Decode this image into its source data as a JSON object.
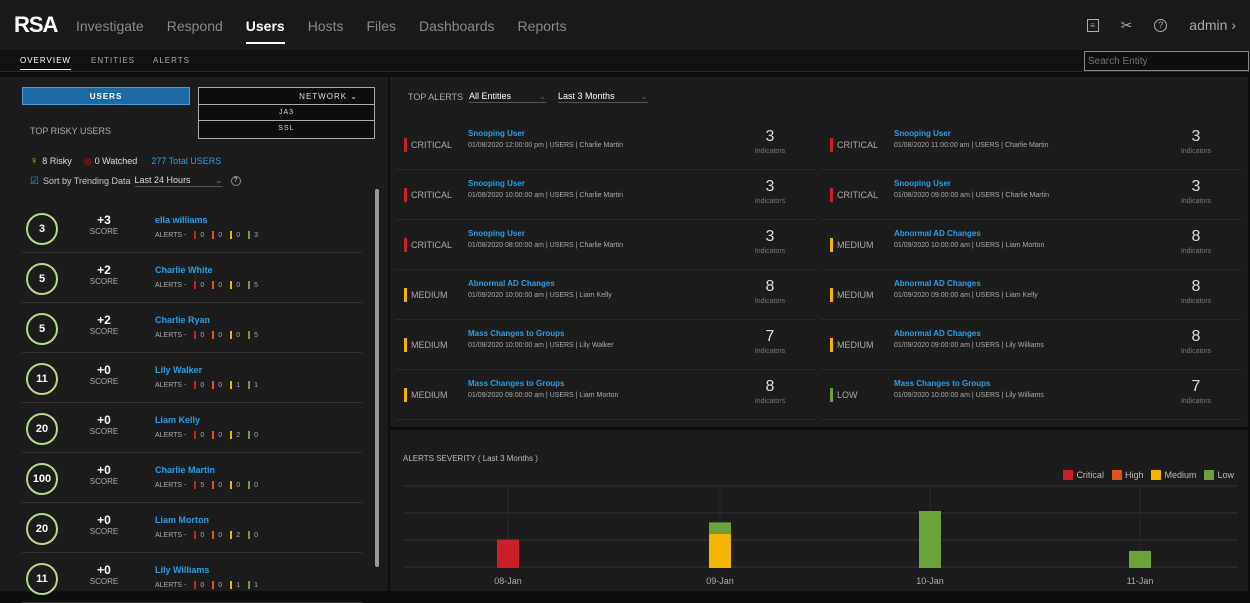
{
  "nav": {
    "logo": "RSA",
    "items": [
      "Investigate",
      "Respond",
      "Users",
      "Hosts",
      "Files",
      "Dashboards",
      "Reports"
    ],
    "user": "admin"
  },
  "subnav": {
    "tabs": [
      "OVERVIEW",
      "ENTITIES",
      "ALERTS"
    ],
    "search_placeholder": "Search Entity"
  },
  "left": {
    "users_btn": "USERS",
    "network_btn": "NETWORK",
    "dd_options": [
      "JA3",
      "SSL"
    ],
    "title": "TOP RISKY USERS",
    "risky": "8 Risky",
    "watched": "0 Watched",
    "total": "277 Total USERS",
    "sort_label": "Sort by Trending Data",
    "sort_value": "Last 24 Hours",
    "users": [
      {
        "score": "3",
        "delta": "+3",
        "name": "ella williams",
        "alerts": [
          "0",
          "0",
          "0",
          "3"
        ]
      },
      {
        "score": "5",
        "delta": "+2",
        "name": "Charlie White",
        "alerts": [
          "0",
          "0",
          "0",
          "5"
        ]
      },
      {
        "score": "5",
        "delta": "+2",
        "name": "Charlie Ryan",
        "alerts": [
          "0",
          "0",
          "0",
          "5"
        ]
      },
      {
        "score": "11",
        "delta": "+0",
        "name": "Lily Walker",
        "alerts": [
          "0",
          "0",
          "1",
          "1"
        ]
      },
      {
        "score": "20",
        "delta": "+0",
        "name": "Liam Kelly",
        "alerts": [
          "0",
          "0",
          "2",
          "0"
        ]
      },
      {
        "score": "100",
        "delta": "+0",
        "name": "Charlie Martin",
        "alerts": [
          "5",
          "0",
          "0",
          "0"
        ]
      },
      {
        "score": "20",
        "delta": "+0",
        "name": "Liam Morton",
        "alerts": [
          "0",
          "0",
          "2",
          "0"
        ]
      },
      {
        "score": "11",
        "delta": "+0",
        "name": "Lily Williams",
        "alerts": [
          "0",
          "0",
          "1",
          "1"
        ]
      }
    ],
    "score_label": "SCORE",
    "alerts_label": "ALERTS -"
  },
  "top_alerts": {
    "title": "TOP ALERTS",
    "filter1": "All Entities",
    "filter2": "Last 3 Months",
    "indicators_label": "Indicators",
    "alerts": [
      {
        "sev": "CRITICAL",
        "title": "Snooping User",
        "meta": "01/08/2020 12:00:00 pm  |  USERS  |  Charlie Martin",
        "count": "3"
      },
      {
        "sev": "CRITICAL",
        "title": "Snooping User",
        "meta": "01/08/2020 11:00:00 am  |  USERS  |  Charlie Martin",
        "count": "3"
      },
      {
        "sev": "CRITICAL",
        "title": "Snooping User",
        "meta": "01/08/2020 10:00:00 am  |  USERS  |  Charlie Martin",
        "count": "3"
      },
      {
        "sev": "CRITICAL",
        "title": "Snooping User",
        "meta": "01/08/2020 09:00:00 am  |  USERS  |  Charlie Martin",
        "count": "3"
      },
      {
        "sev": "CRITICAL",
        "title": "Snooping User",
        "meta": "01/08/2020 08:00:00 am  |  USERS  |  Charlie Martin",
        "count": "3"
      },
      {
        "sev": "MEDIUM",
        "title": "Abnormal AD Changes",
        "meta": "01/09/2020 10:00:00 am  |  USERS  |  Liam Morton",
        "count": "8"
      },
      {
        "sev": "MEDIUM",
        "title": "Abnormal AD Changes",
        "meta": "01/09/2020 10:00:00 am  |  USERS  |  Liam Kelly",
        "count": "8"
      },
      {
        "sev": "MEDIUM",
        "title": "Abnormal AD Changes",
        "meta": "01/09/2020 09:00:00 am  |  USERS  |  Liam Kelly",
        "count": "8"
      },
      {
        "sev": "MEDIUM",
        "title": "Mass Changes to Groups",
        "meta": "01/09/2020 10:00:00 am  |  USERS  |  Lily Walker",
        "count": "7"
      },
      {
        "sev": "MEDIUM",
        "title": "Abnormal AD Changes",
        "meta": "01/09/2020 09:00:00 am  |  USERS  |  Lily Williams",
        "count": "8"
      },
      {
        "sev": "MEDIUM",
        "title": "Mass Changes to Groups",
        "meta": "01/09/2020 09:00:00 am  |  USERS  |  Liam Morton",
        "count": "8"
      },
      {
        "sev": "LOW",
        "title": "Mass Changes to Groups",
        "meta": "01/09/2020 10:00:00 am  |  USERS  |  Lily Williams",
        "count": "7"
      }
    ]
  },
  "colors": {
    "critical": "#c9202a",
    "high": "#e2531c",
    "medium": "#f5b400",
    "low": "#6aa33b",
    "link": "#2a9fe6"
  },
  "chart_data": {
    "type": "bar",
    "title": "ALERTS SEVERITY ( Last 3 Months )",
    "categories": [
      "08-Jan",
      "09-Jan",
      "10-Jan",
      "11-Jan"
    ],
    "series": [
      {
        "name": "Critical",
        "values": [
          5,
          0,
          0,
          0
        ]
      },
      {
        "name": "High",
        "values": [
          0,
          0,
          0,
          0
        ]
      },
      {
        "name": "Medium",
        "values": [
          0,
          6,
          0,
          0
        ]
      },
      {
        "name": "Low",
        "values": [
          0,
          2,
          10,
          3
        ]
      }
    ],
    "stacked": true,
    "legend": "top-right",
    "grid": false
  }
}
